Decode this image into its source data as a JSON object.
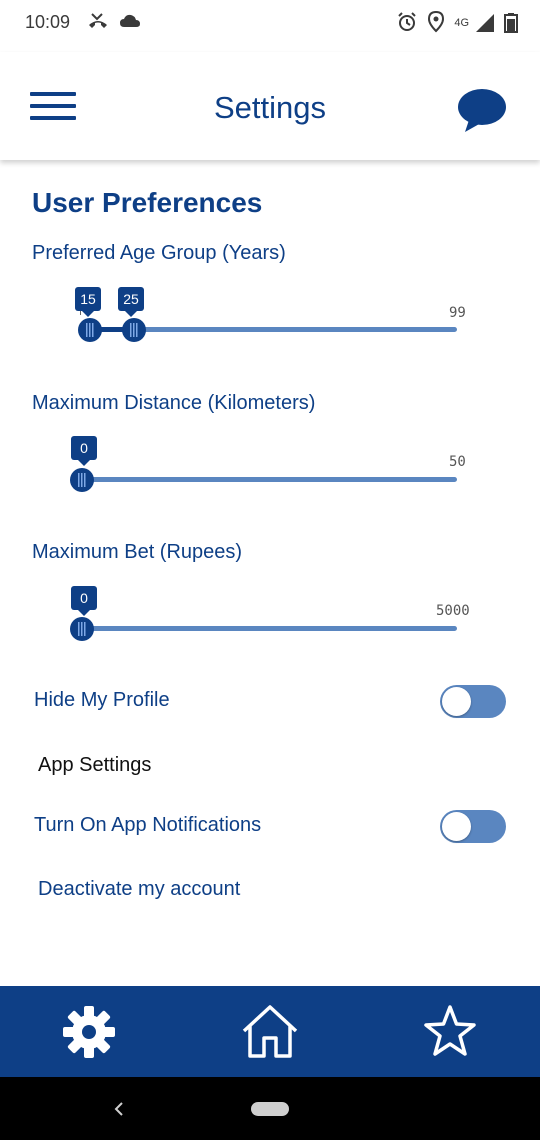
{
  "status_bar": {
    "time": "10:09",
    "network": "4G",
    "icons": [
      "missed-call-icon",
      "cloud-icon",
      "alarm-icon",
      "location-icon",
      "signal-icon",
      "battery-icon"
    ]
  },
  "header": {
    "title": "Settings",
    "menu_icon": "hamburger-menu-icon",
    "chat_icon": "chat-bubble-icon"
  },
  "preferences": {
    "section_title": "User Preferences",
    "age": {
      "label": "Preferred Age Group (Years)",
      "min_value": "15",
      "max_value": "25",
      "range_max": "99"
    },
    "distance": {
      "label": "Maximum Distance (Kilometers)",
      "value": "0",
      "range_max": "50"
    },
    "bet": {
      "label": "Maximum Bet (Rupees)",
      "value": "0",
      "range_max": "5000"
    },
    "hide_profile": {
      "label": "Hide My Profile",
      "on": false
    }
  },
  "app_settings": {
    "title": "App Settings",
    "notifications": {
      "label": "Turn On App Notifications",
      "on": false
    },
    "deactivate_label": "Deactivate my account"
  },
  "bottom_nav": {
    "items": [
      "gear-icon",
      "home-icon",
      "star-icon"
    ]
  },
  "colors": {
    "primary": "#0e3f86",
    "track": "#5a86c0",
    "system_bar": "#000000"
  }
}
